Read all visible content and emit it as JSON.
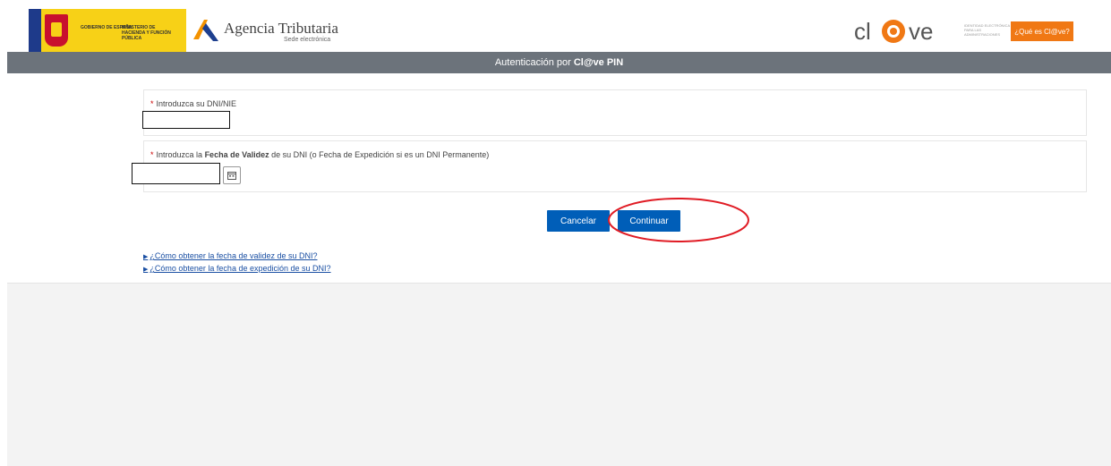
{
  "header": {
    "gov_text_1": "GOBIERNO DE ESPAÑA",
    "gov_text_2": "MINISTERIO DE HACIENDA Y FUNCIÓN PÚBLICA",
    "agency_title": "Agencia Tributaria",
    "agency_subtitle": "Sede electrónica",
    "clave_subtitle": "IDENTIDAD ELECTRÓNICA PARA LAS ADMINISTRACIONES",
    "que_es_button": "¿Qué es Cl@ve?"
  },
  "band": {
    "prefix": "Autenticación por",
    "strong": "Cl@ve PIN"
  },
  "form": {
    "dni_label": "Introduzca su DNI/NIE",
    "dni_value": "",
    "fecha_label_pre": "Introduzca la",
    "fecha_label_bold": "Fecha de Validez",
    "fecha_label_post": "de su DNI (o Fecha de Expedición si es un DNI Permanente)",
    "fecha_value": "",
    "required_mark": "*"
  },
  "buttons": {
    "cancel": "Cancelar",
    "continue": "Continuar"
  },
  "links": [
    {
      "label": "¿Cómo obtener la fecha de validez de su DNI?"
    },
    {
      "label": "¿Cómo obtener la fecha de expedición de su DNI?"
    }
  ],
  "colors": {
    "band": "#6c737b",
    "primary_button": "#005eb8",
    "orange_button": "#f07814",
    "annotation_oval": "#e01b24"
  },
  "icons": {
    "calendar": "calendar-icon",
    "link_arrow": "triangle-right-icon"
  }
}
